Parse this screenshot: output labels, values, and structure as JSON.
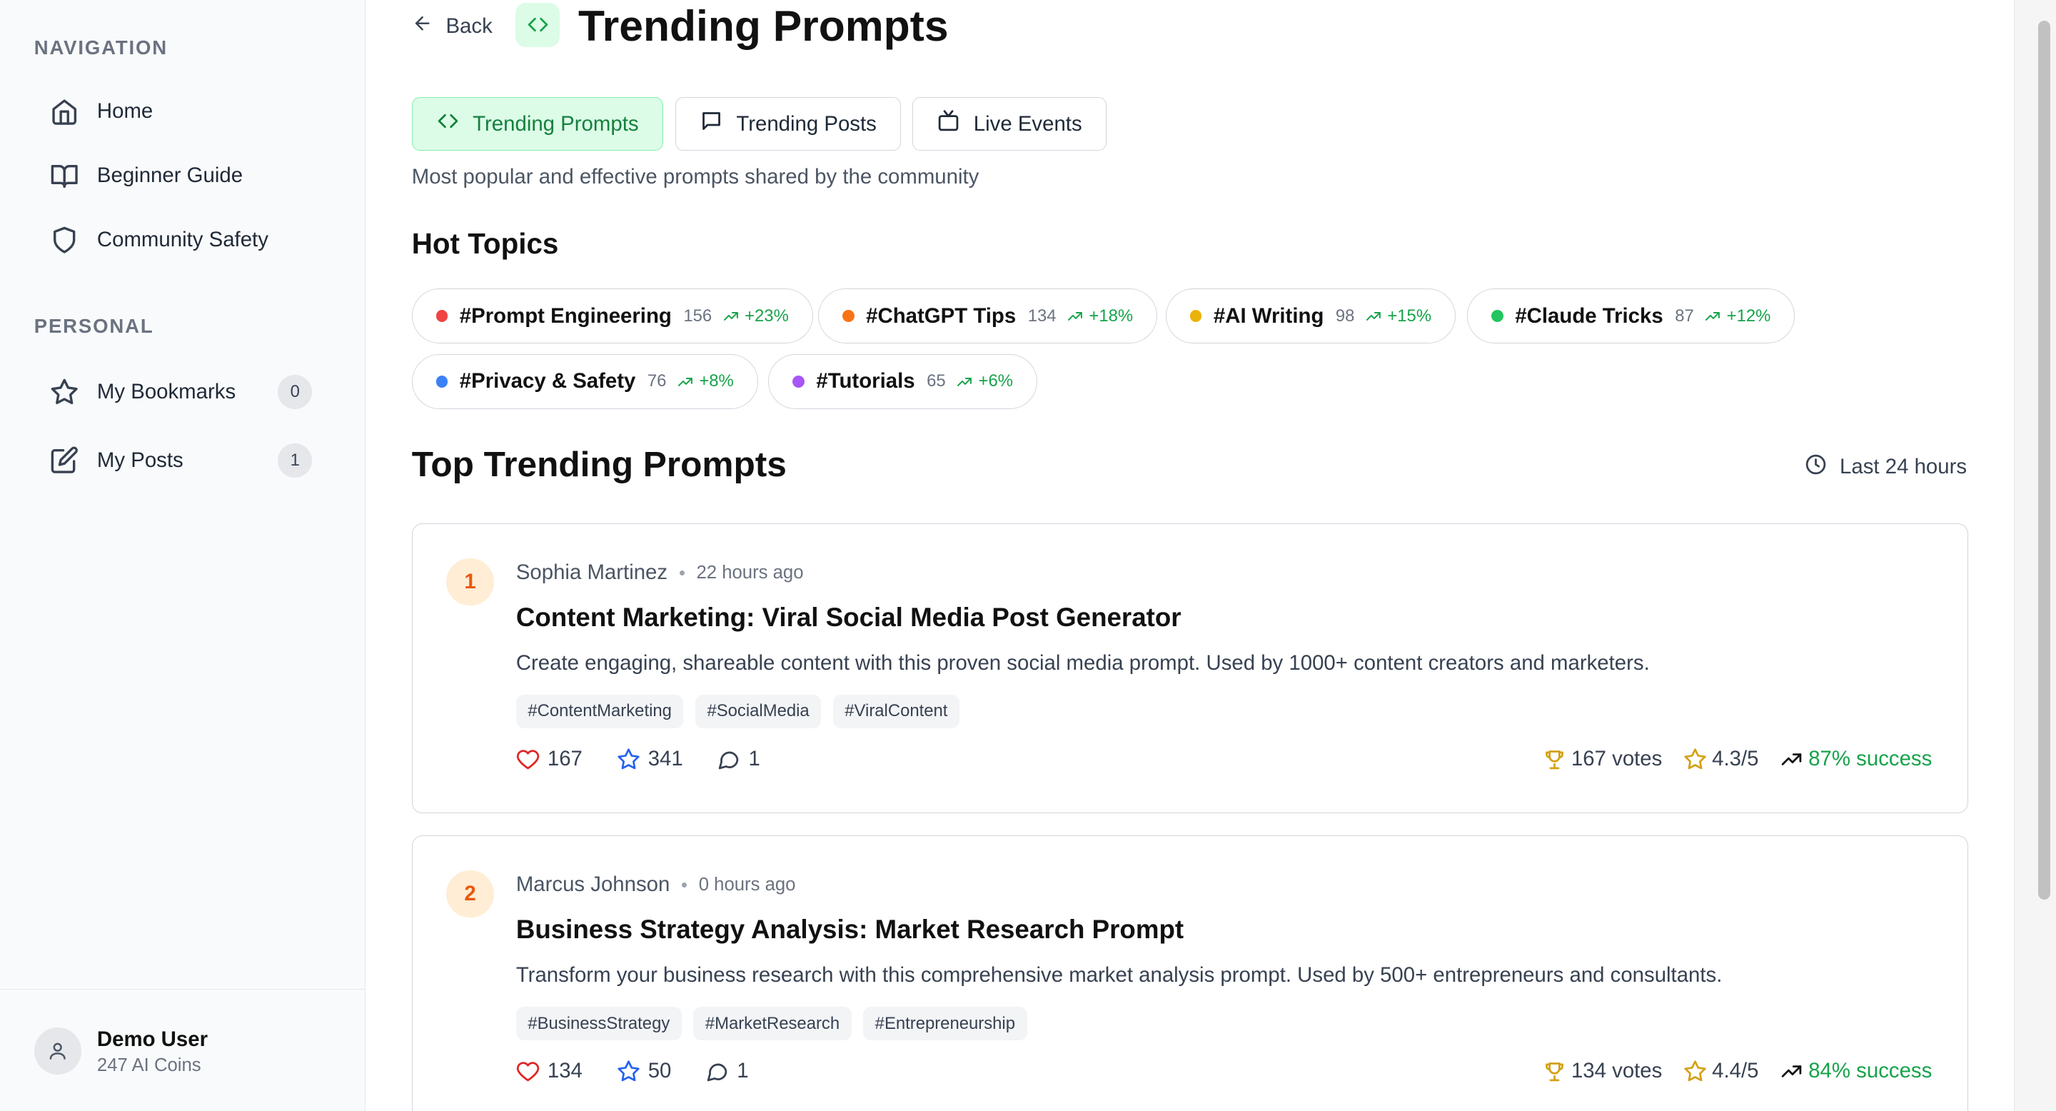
{
  "sidebar": {
    "nav_heading": "NAVIGATION",
    "nav_items": [
      {
        "label": "Home",
        "icon": "home-icon"
      },
      {
        "label": "Beginner Guide",
        "icon": "book-icon"
      },
      {
        "label": "Community Safety",
        "icon": "shield-icon"
      }
    ],
    "personal_heading": "PERSONAL",
    "personal_items": [
      {
        "label": "My Bookmarks",
        "icon": "star-icon",
        "count": "0"
      },
      {
        "label": "My Posts",
        "icon": "edit-icon",
        "count": "1"
      }
    ],
    "user": {
      "name": "Demo User",
      "coins": "247 AI Coins"
    }
  },
  "header": {
    "back_label": "Back",
    "title": "Trending Prompts",
    "tabs": [
      {
        "label": "Trending Prompts",
        "icon": "code-icon",
        "active": true
      },
      {
        "label": "Trending Posts",
        "icon": "message-icon",
        "active": false
      },
      {
        "label": "Live Events",
        "icon": "tv-icon",
        "active": false
      }
    ],
    "subtitle": "Most popular and effective prompts shared by the community"
  },
  "hot_topics": {
    "title": "Hot Topics",
    "items": [
      {
        "name": "#Prompt Engineering",
        "count": "156",
        "trend": "+23%",
        "color": "#ef4444"
      },
      {
        "name": "#ChatGPT Tips",
        "count": "134",
        "trend": "+18%",
        "color": "#f97316"
      },
      {
        "name": "#AI Writing",
        "count": "98",
        "trend": "+15%",
        "color": "#eab308"
      },
      {
        "name": "#Claude Tricks",
        "count": "87",
        "trend": "+12%",
        "color": "#22c55e"
      },
      {
        "name": "#Privacy & Safety",
        "count": "76",
        "trend": "+8%",
        "color": "#3b82f6"
      },
      {
        "name": "#Tutorials",
        "count": "65",
        "trend": "+6%",
        "color": "#a855f7"
      }
    ]
  },
  "top_prompts": {
    "title": "Top Trending Prompts",
    "range_label": "Last 24 hours",
    "cards": [
      {
        "rank": "1",
        "author": "Sophia Martinez",
        "time": "22 hours ago",
        "title": "Content Marketing: Viral Social Media Post Generator",
        "description": "Create engaging, shareable content with this proven social media prompt. Used by 1000+ content creators and marketers.",
        "tags": [
          "#ContentMarketing",
          "#SocialMedia",
          "#ViralContent"
        ],
        "likes": "167",
        "stars": "341",
        "comments": "1",
        "votes": "167 votes",
        "rating": "4.3/5",
        "success": "87% success"
      },
      {
        "rank": "2",
        "author": "Marcus Johnson",
        "time": "0 hours ago",
        "title": "Business Strategy Analysis: Market Research Prompt",
        "description": "Transform your business research with this comprehensive market analysis prompt. Used by 500+ entrepreneurs and consultants.",
        "tags": [
          "#BusinessStrategy",
          "#MarketResearch",
          "#Entrepreneurship"
        ],
        "likes": "134",
        "stars": "50",
        "comments": "1",
        "votes": "134 votes",
        "rating": "4.4/5",
        "success": "84% success"
      }
    ]
  },
  "colors": {
    "accent": "#16a34a",
    "accent_bg": "#dcfce7",
    "rank_bg": "#ffedd5",
    "rank_fg": "#ea580c",
    "trophy": "#d4a017"
  }
}
